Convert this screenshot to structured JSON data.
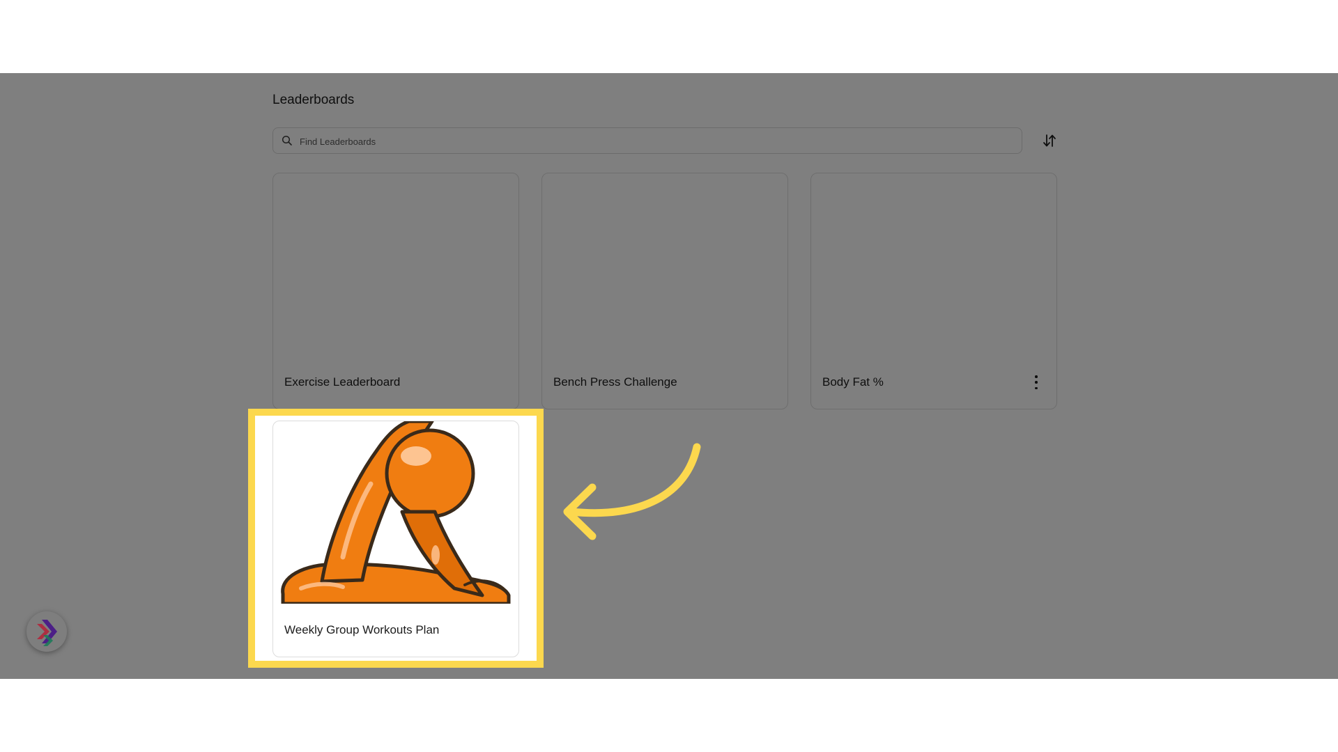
{
  "page": {
    "title": "Leaderboards"
  },
  "search": {
    "placeholder": "Find Leaderboards",
    "value": ""
  },
  "sort": {
    "icon": "sort-arrows-icon"
  },
  "leaderboards": [
    {
      "label": "Exercise Leaderboard",
      "has_menu": false,
      "has_image": false
    },
    {
      "label": "Bench Press Challenge",
      "has_menu": false,
      "has_image": false
    },
    {
      "label": "Body Fat %",
      "has_menu": true,
      "has_image": false
    },
    {
      "label": "Weekly Group Workouts Plan",
      "has_menu": false,
      "has_image": true,
      "image": "orange-figure-stretching-illustration"
    }
  ],
  "annotation": {
    "highlight_color": "#fcd84e",
    "arrow_color": "#fcd84e"
  },
  "colors": {
    "overlay": "rgba(0,0,0,0.5)",
    "illustration_orange": "#f07d11",
    "illustration_dark_orange": "#c85a05"
  }
}
